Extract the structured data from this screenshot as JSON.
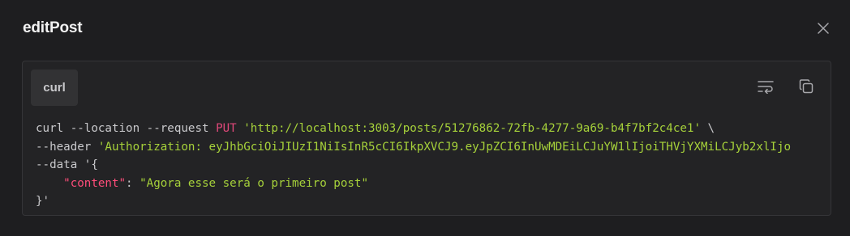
{
  "modal": {
    "title": "editPost"
  },
  "tabs": [
    {
      "label": "curl"
    }
  ],
  "code": {
    "line1": {
      "cmd": "curl --location --request ",
      "method": "PUT",
      "space": " ",
      "url": "'http://localhost:3003/posts/51276862-72fb-4277-9a69-b4f7bf2c4ce1'",
      "cont": " \\"
    },
    "line2": {
      "flag": "--header ",
      "value": "'Authorization: eyJhbGciOiJIUzI1NiIsInR5cCI6IkpXVCJ9.eyJpZCI6InUwMDEiLCJuYW1lIjoiTHVjYXMiLCJyb2xlIjo"
    },
    "line3": {
      "flag": "--data '{"
    },
    "line4": {
      "indent": "    ",
      "key": "\"content\"",
      "colon": ": ",
      "value": "\"Agora esse será o primeiro post\""
    },
    "line5": {
      "text": "}'"
    }
  },
  "icons": {
    "close": "close-icon",
    "wrap": "wrap-text-icon",
    "copy": "copy-icon"
  },
  "colors": {
    "background": "#1e1e20",
    "panel": "#232325",
    "method": "#e0487a",
    "string": "#a6d13a",
    "key": "#ff4d7a"
  }
}
